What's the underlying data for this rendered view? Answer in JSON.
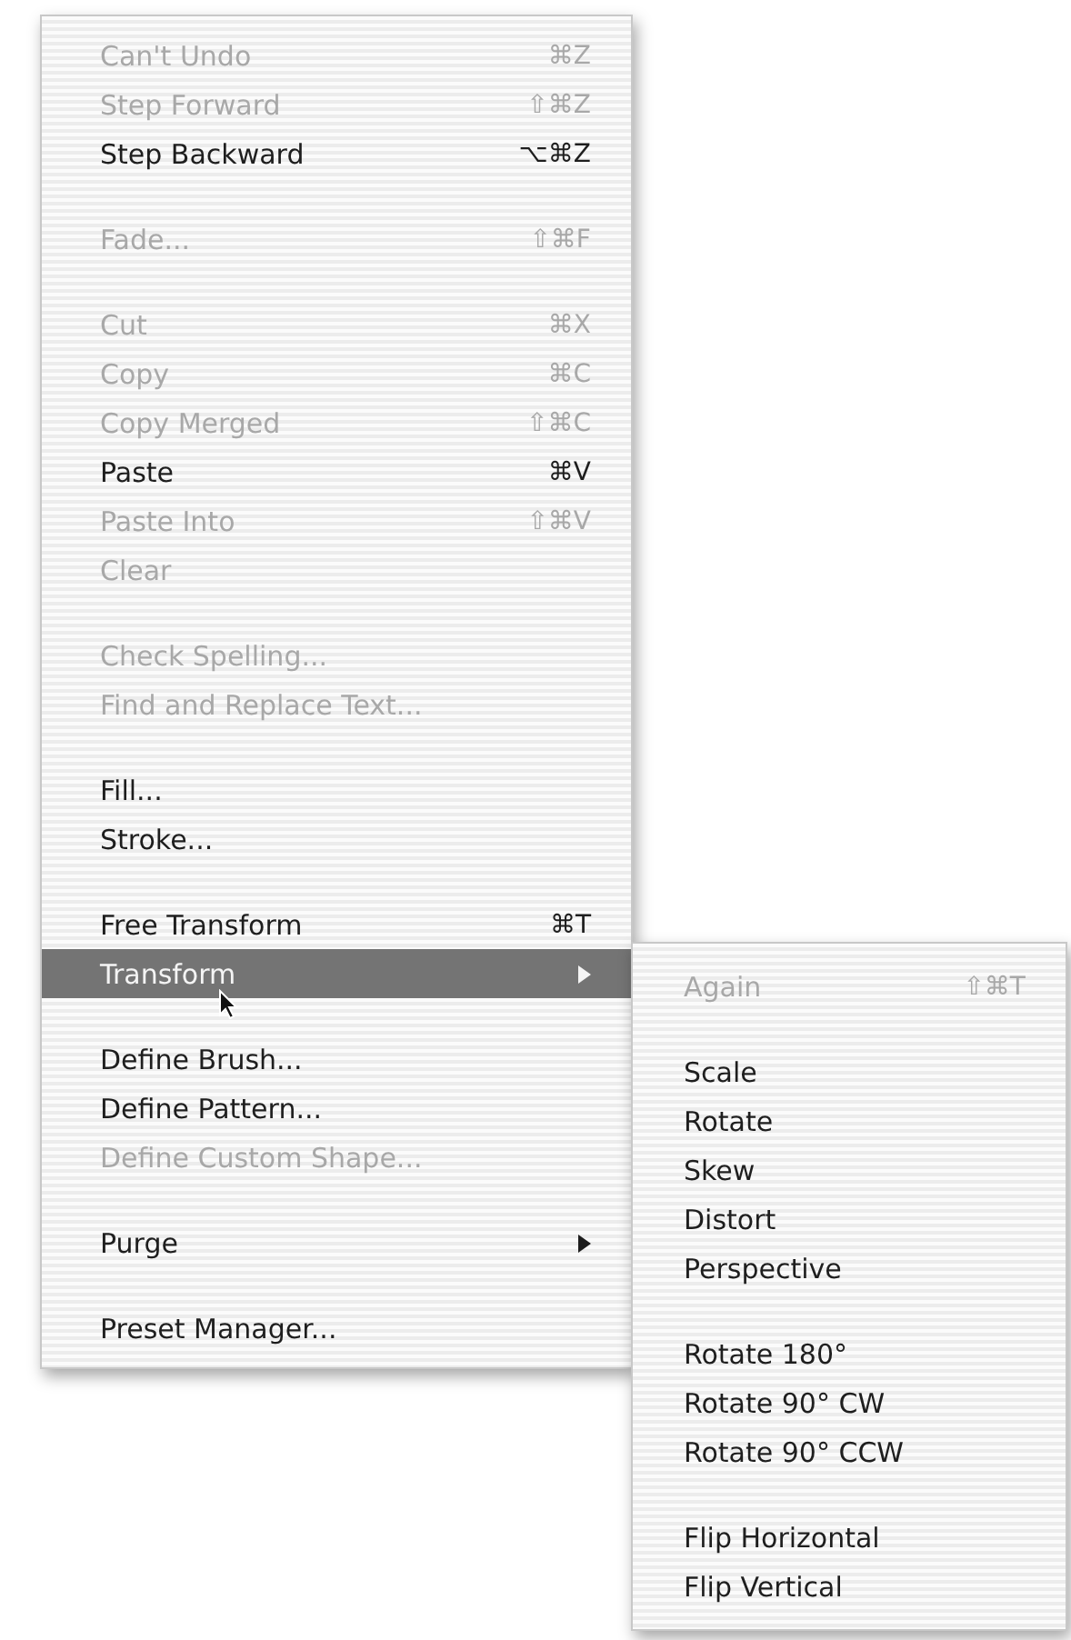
{
  "edit_menu": {
    "items": [
      {
        "kind": "item",
        "label": "Can't Undo",
        "shortcut": "⌘Z",
        "disabled": true,
        "selected": false,
        "has_submenu": false
      },
      {
        "kind": "item",
        "label": "Step Forward",
        "shortcut": "⇧⌘Z",
        "disabled": true,
        "selected": false,
        "has_submenu": false
      },
      {
        "kind": "item",
        "label": "Step Backward",
        "shortcut": "⌥⌘Z",
        "disabled": false,
        "selected": false,
        "has_submenu": false
      },
      {
        "kind": "separator"
      },
      {
        "kind": "item",
        "label": "Fade...",
        "shortcut": "⇧⌘F",
        "disabled": true,
        "selected": false,
        "has_submenu": false
      },
      {
        "kind": "separator"
      },
      {
        "kind": "item",
        "label": "Cut",
        "shortcut": "⌘X",
        "disabled": true,
        "selected": false,
        "has_submenu": false
      },
      {
        "kind": "item",
        "label": "Copy",
        "shortcut": "⌘C",
        "disabled": true,
        "selected": false,
        "has_submenu": false
      },
      {
        "kind": "item",
        "label": "Copy Merged",
        "shortcut": "⇧⌘C",
        "disabled": true,
        "selected": false,
        "has_submenu": false
      },
      {
        "kind": "item",
        "label": "Paste",
        "shortcut": "⌘V",
        "disabled": false,
        "selected": false,
        "has_submenu": false
      },
      {
        "kind": "item",
        "label": "Paste Into",
        "shortcut": "⇧⌘V",
        "disabled": true,
        "selected": false,
        "has_submenu": false
      },
      {
        "kind": "item",
        "label": "Clear",
        "disabled": true,
        "selected": false,
        "has_submenu": false
      },
      {
        "kind": "separator"
      },
      {
        "kind": "item",
        "label": "Check Spelling...",
        "disabled": true,
        "selected": false,
        "has_submenu": false
      },
      {
        "kind": "item",
        "label": "Find and Replace Text...",
        "disabled": true,
        "selected": false,
        "has_submenu": false
      },
      {
        "kind": "separator"
      },
      {
        "kind": "item",
        "label": "Fill...",
        "disabled": false,
        "selected": false,
        "has_submenu": false
      },
      {
        "kind": "item",
        "label": "Stroke...",
        "disabled": false,
        "selected": false,
        "has_submenu": false
      },
      {
        "kind": "separator"
      },
      {
        "kind": "item",
        "label": "Free Transform",
        "shortcut": "⌘T",
        "disabled": false,
        "selected": false,
        "has_submenu": false
      },
      {
        "kind": "item",
        "label": "Transform",
        "disabled": false,
        "selected": true,
        "has_submenu": true
      },
      {
        "kind": "separator"
      },
      {
        "kind": "item",
        "label": "Define Brush...",
        "disabled": false,
        "selected": false,
        "has_submenu": false
      },
      {
        "kind": "item",
        "label": "Define Pattern...",
        "disabled": false,
        "selected": false,
        "has_submenu": false
      },
      {
        "kind": "item",
        "label": "Define Custom Shape...",
        "disabled": true,
        "selected": false,
        "has_submenu": false
      },
      {
        "kind": "separator"
      },
      {
        "kind": "item",
        "label": "Purge",
        "disabled": false,
        "selected": false,
        "has_submenu": true
      },
      {
        "kind": "separator"
      },
      {
        "kind": "item",
        "label": "Preset Manager...",
        "disabled": false,
        "selected": false,
        "has_submenu": false
      }
    ]
  },
  "transform_submenu": {
    "items": [
      {
        "kind": "item",
        "label": "Again",
        "shortcut": "⇧⌘T",
        "disabled": true,
        "selected": false,
        "has_submenu": false
      },
      {
        "kind": "separator"
      },
      {
        "kind": "item",
        "label": "Scale",
        "disabled": false,
        "selected": false,
        "has_submenu": false
      },
      {
        "kind": "item",
        "label": "Rotate",
        "disabled": false,
        "selected": false,
        "has_submenu": false
      },
      {
        "kind": "item",
        "label": "Skew",
        "disabled": false,
        "selected": false,
        "has_submenu": false
      },
      {
        "kind": "item",
        "label": "Distort",
        "disabled": false,
        "selected": false,
        "has_submenu": false
      },
      {
        "kind": "item",
        "label": "Perspective",
        "disabled": false,
        "selected": false,
        "has_submenu": false
      },
      {
        "kind": "separator"
      },
      {
        "kind": "item",
        "label": "Rotate 180°",
        "disabled": false,
        "selected": false,
        "has_submenu": false
      },
      {
        "kind": "item",
        "label": "Rotate 90° CW",
        "disabled": false,
        "selected": false,
        "has_submenu": false
      },
      {
        "kind": "item",
        "label": "Rotate 90° CCW",
        "disabled": false,
        "selected": false,
        "has_submenu": false
      },
      {
        "kind": "separator"
      },
      {
        "kind": "item",
        "label": "Flip Horizontal",
        "disabled": false,
        "selected": false,
        "has_submenu": false
      },
      {
        "kind": "item",
        "label": "Flip Vertical",
        "disabled": false,
        "selected": false,
        "has_submenu": false
      }
    ]
  }
}
